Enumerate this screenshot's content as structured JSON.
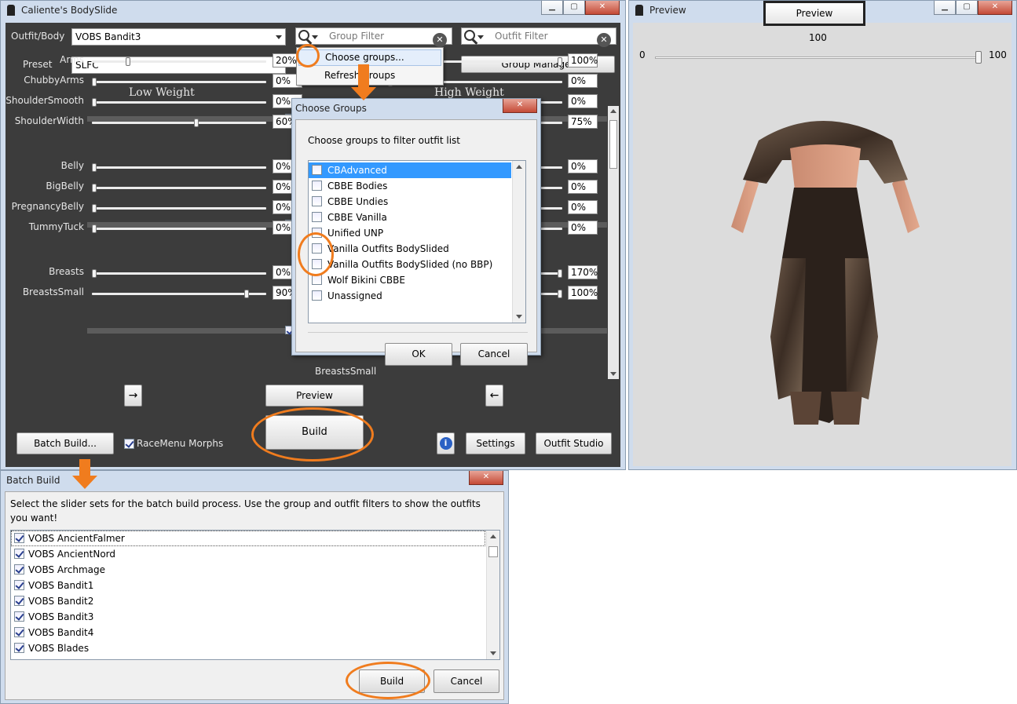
{
  "main_window": {
    "title": "Caliente's BodySlide",
    "outfit_label": "Outfit/Body",
    "outfit_value": "VOBS Bandit3",
    "preset_label": "Preset",
    "preset_value": "SLFC",
    "group_filter_placeholder": "Group Filter",
    "outfit_filter_placeholder": "Outfit Filter",
    "group_manager_label": "Group Manager",
    "low_weight_header": "Low Weight",
    "high_weight_header": "High Weight",
    "group_menu": {
      "items": [
        "Choose groups...",
        "Refresh groups"
      ]
    },
    "sliders": [
      {
        "name": "Arms",
        "low": "20%",
        "high": "100%",
        "low_pos": 0.2,
        "high_pos": 1.0
      },
      {
        "name": "ChubbyArms",
        "low": "0%",
        "high": "0%",
        "low_pos": 0.0,
        "high_pos": 0.0
      },
      {
        "name": "ShoulderSmooth",
        "low": "0%",
        "high": "0%",
        "low_pos": 0.0,
        "high_pos": 0.0
      },
      {
        "name": "ShoulderWidth",
        "low": "60%",
        "high": "75%",
        "low_pos": 0.6,
        "high_pos": 0.75
      },
      {
        "name": "Belly",
        "low": "0%",
        "high": "0%",
        "low_pos": 0.0,
        "high_pos": 0.0
      },
      {
        "name": "BigBelly",
        "low": "0%",
        "high": "0%",
        "low_pos": 0.0,
        "high_pos": 0.0
      },
      {
        "name": "PregnancyBelly",
        "low": "0%",
        "high": "0%",
        "low_pos": 0.0,
        "high_pos": 0.0
      },
      {
        "name": "TummyTuck",
        "low": "0%",
        "high": "0%",
        "low_pos": 0.0,
        "high_pos": 0.0
      },
      {
        "name": "Breasts",
        "low": "0%",
        "high": "170%",
        "low_pos": 0.0,
        "high_pos": 1.0
      },
      {
        "name": "BreastsSmall",
        "low": "90%",
        "high": "100%",
        "low_pos": 0.9,
        "high_pos": 1.0
      }
    ],
    "breasts_small_high_label": "BreastsSmall",
    "arrow_right": "→",
    "arrow_left": "←",
    "preview_button": "Preview",
    "build_button": "Build",
    "batch_build_button": "Batch Build...",
    "racemenu_label": "RaceMenu Morphs",
    "info_icon_text": "i",
    "settings_button": "Settings",
    "outfit_studio_button": "Outfit Studio"
  },
  "choose_groups": {
    "title": "Choose Groups",
    "prompt": "Choose groups to filter outfit list",
    "items": [
      {
        "label": "CBAdvanced",
        "checked": false,
        "selected": true
      },
      {
        "label": "CBBE Bodies",
        "checked": false,
        "selected": false
      },
      {
        "label": "CBBE Undies",
        "checked": false,
        "selected": false
      },
      {
        "label": "CBBE Vanilla",
        "checked": false,
        "selected": false
      },
      {
        "label": "Unified UNP",
        "checked": false,
        "selected": false
      },
      {
        "label": "Vanilla Outfits BodySlided",
        "checked": false,
        "selected": false
      },
      {
        "label": "Vanilla Outfits BodySlided (no BBP)",
        "checked": false,
        "selected": false
      },
      {
        "label": "Wolf Bikini CBBE",
        "checked": false,
        "selected": false
      },
      {
        "label": "Unassigned",
        "checked": false,
        "selected": false
      }
    ],
    "ok_label": "OK",
    "cancel_label": "Cancel"
  },
  "preview_window": {
    "title": "Preview",
    "preview_tab": "Preview",
    "slider_value": "100",
    "slider_min": "0",
    "slider_max": "100",
    "slider_level": 1.0
  },
  "batch_build": {
    "title": "Batch Build",
    "description": "Select the slider sets for the batch build process. Use the group and outfit filters to show the outfits you want!",
    "items": [
      {
        "label": "VOBS AncientFalmer",
        "checked": true
      },
      {
        "label": "VOBS AncientNord",
        "checked": true
      },
      {
        "label": "VOBS Archmage",
        "checked": true
      },
      {
        "label": "VOBS Bandit1",
        "checked": true
      },
      {
        "label": "VOBS Bandit2",
        "checked": true
      },
      {
        "label": "VOBS Bandit3",
        "checked": true
      },
      {
        "label": "VOBS Bandit4",
        "checked": true
      },
      {
        "label": "VOBS Blades",
        "checked": true
      }
    ],
    "build_label": "Build",
    "cancel_label": "Cancel"
  }
}
